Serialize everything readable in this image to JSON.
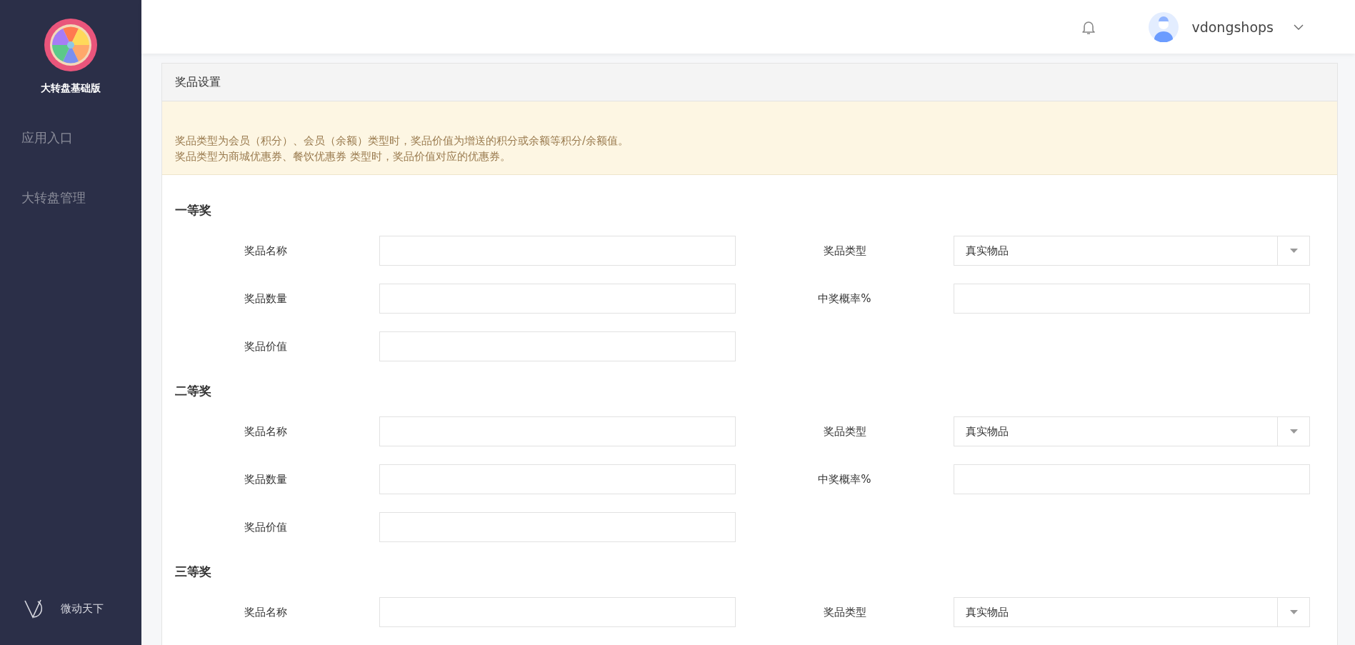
{
  "sidebar": {
    "app_title": "大转盘基础版",
    "items": [
      {
        "label": "应用入口",
        "selected": false
      },
      {
        "label": "大转盘管理",
        "selected": false
      }
    ],
    "footer_brand": "微动天下"
  },
  "header": {
    "username": "vdongshops"
  },
  "panel": {
    "title": "奖品设置",
    "notice": [
      "奖品类型为会员（积分）、会员（余额）类型时，奖品价值为增送的积分或余额等积分/余额值。",
      "奖品类型为商城优惠券、餐饮优惠券 类型时，奖品价值对应的优惠券。"
    ],
    "sections": [
      {
        "title": "一等奖",
        "fields": [
          {
            "label": "奖品名称",
            "kind": "text"
          },
          {
            "label": "奖品类型",
            "kind": "select",
            "value": "真实物品"
          },
          {
            "label": "奖品数量",
            "kind": "text"
          },
          {
            "label": "中奖概率%",
            "kind": "text"
          },
          {
            "label": "奖品价值",
            "kind": "text"
          }
        ]
      },
      {
        "title": "二等奖",
        "fields": [
          {
            "label": "奖品名称",
            "kind": "text"
          },
          {
            "label": "奖品类型",
            "kind": "select",
            "value": "真实物品"
          },
          {
            "label": "奖品数量",
            "kind": "text"
          },
          {
            "label": "中奖概率%",
            "kind": "text"
          },
          {
            "label": "奖品价值",
            "kind": "text"
          }
        ]
      },
      {
        "title": "三等奖",
        "fields": [
          {
            "label": "奖品名称",
            "kind": "text"
          },
          {
            "label": "奖品类型",
            "kind": "select",
            "value": "真实物品"
          }
        ]
      }
    ]
  }
}
